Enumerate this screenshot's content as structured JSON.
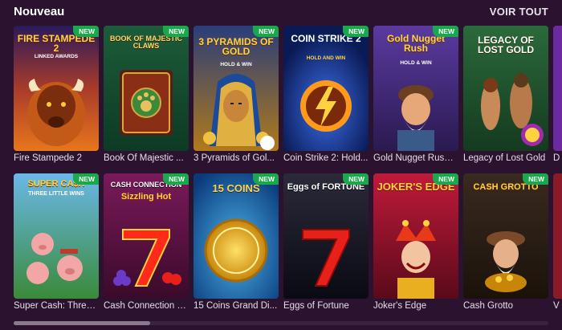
{
  "section": {
    "title": "Nouveau",
    "view_all": "VOIR TOUT"
  },
  "badge_new": "NEW",
  "row1": [
    {
      "title": "Fire Stampede 2",
      "art": "FIRE STAMPEDE 2",
      "sub": "LINKED AWARDS",
      "badge": "NEW"
    },
    {
      "title": "Book Of Majestic ...",
      "art": "BOOK OF MAJESTIC CLAWS",
      "sub": "",
      "badge": "NEW"
    },
    {
      "title": "3 Pyramids of Gol...",
      "art": "3 PYRAMIDS OF GOLD",
      "sub": "HOLD & WIN",
      "badge": "NEW"
    },
    {
      "title": "Coin Strike 2: Hold...",
      "art": "COIN STRIKE 2",
      "sub": "HOLD AND WIN",
      "badge": "NEW"
    },
    {
      "title": "Gold Nugget Rush ...",
      "art": "Gold Nugget Rush",
      "sub": "HOLD & WIN",
      "badge": "NEW"
    },
    {
      "title": "Legacy of Lost Gold",
      "art": "LEGACY OF LOST GOLD",
      "sub": "",
      "badge": ""
    },
    {
      "title": "D",
      "art": "",
      "sub": "",
      "badge": ""
    }
  ],
  "row2": [
    {
      "title": "Super Cash: Three...",
      "art": "SUPER CA$H",
      "sub": "THREE LITTLE WINS",
      "badge": "NEW"
    },
    {
      "title": "Cash Connection S...",
      "art": "CASH CONNECTION",
      "sub": "Sizzling Hot",
      "badge": "NEW"
    },
    {
      "title": "15 Coins Grand Di...",
      "art": "15 COINS",
      "sub": "",
      "badge": "NEW"
    },
    {
      "title": "Eggs of Fortune",
      "art": "Eggs of FORTUNE",
      "sub": "",
      "badge": "NEW"
    },
    {
      "title": "Joker's Edge",
      "art": "JOKER'S EDGE",
      "sub": "",
      "badge": "NEW"
    },
    {
      "title": "Cash Grotto",
      "art": "CASH GROTTO",
      "sub": "",
      "badge": "NEW"
    },
    {
      "title": "V",
      "art": "",
      "sub": "",
      "badge": ""
    }
  ],
  "colors": {
    "background": "#2b1330",
    "badge": "#1aa84c"
  }
}
